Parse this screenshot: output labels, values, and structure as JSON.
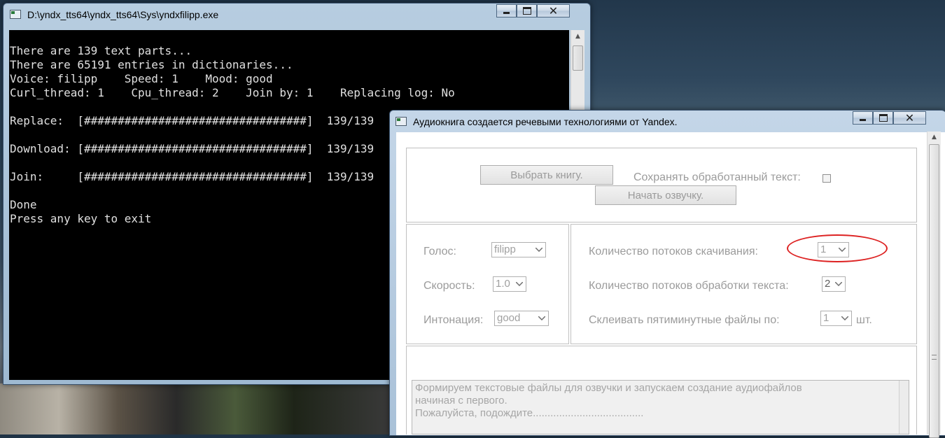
{
  "console": {
    "title": "D:\\yndx_tts64\\yndx_tts64\\Sys\\yndxfilipp.exe",
    "lines": [
      "There are 139 text parts...",
      "There are 65191 entries in dictionaries...",
      "Voice: filipp    Speed: 1    Mood: good",
      "Curl_thread: 1    Cpu_thread: 2    Join by: 1    Replacing log: No",
      "",
      "Replace:  [#################################]  139/139",
      "",
      "Download: [#################################]  139/139",
      "",
      "Join:     [#################################]  139/139",
      "",
      "Done",
      "Press any key to exit"
    ]
  },
  "app": {
    "title": "Аудиокнига создается речевыми технологиями от Yandex.",
    "choose_book_button": "Выбрать книгу.",
    "save_text_label": "Сохранять обработанный текст:",
    "start_button": "Начать озвучку.",
    "voice_label": "Голос:",
    "voice_value": "filipp",
    "speed_label": "Скорость:",
    "speed_value": "1.0",
    "intonation_label": "Интонация:",
    "intonation_value": "good",
    "download_threads_label": "Количество потоков скачивания:",
    "download_threads_value": "1",
    "processing_threads_label": "Количество потоков обработки текста:",
    "processing_threads_value": "2",
    "join_label": "Склеивать пятиминутные файлы по:",
    "join_value": "1",
    "join_unit": "шт.",
    "status_lines": [
      "Формируем текстовые файлы для озвучки и запускаем создание аудиофайлов",
      "начиная с первого.",
      "Пожалуйста, подождите......................................"
    ]
  },
  "colors": {
    "highlight_ellipse": "#dd2222",
    "console_bg": "#000000",
    "console_text": "#e0e0e0"
  }
}
